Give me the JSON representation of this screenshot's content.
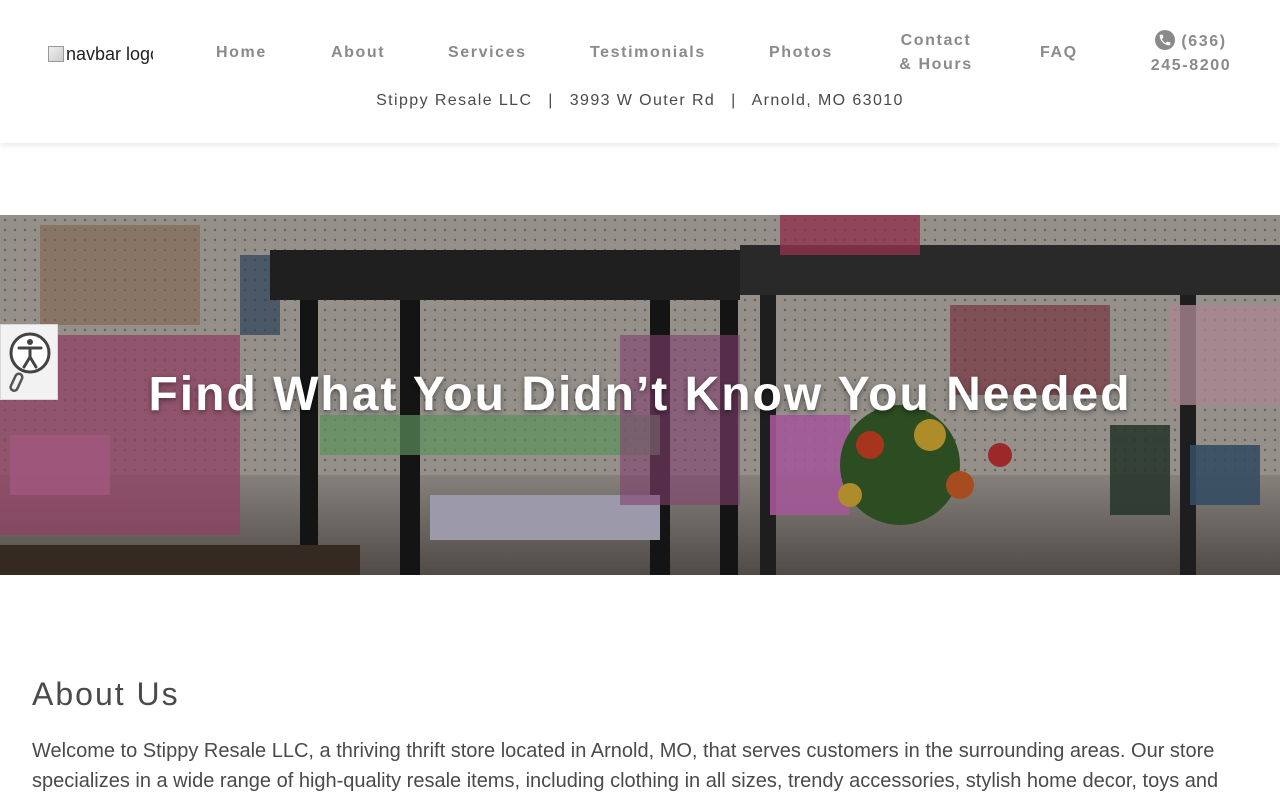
{
  "header": {
    "logo_alt": "navbar logo",
    "nav": {
      "home": "Home",
      "about": "About",
      "services": "Services",
      "testimonials": "Testimonials",
      "photos": "Photos",
      "contact_line1": "Contact",
      "contact_line2": "& Hours",
      "faq": "FAQ",
      "phone_line1": "(636)",
      "phone_line2": "245-8200"
    },
    "address": {
      "business": "Stippy Resale LLC",
      "street": "3993 W Outer Rd",
      "city": "Arnold, MO 63010",
      "separator": "|"
    }
  },
  "hero": {
    "title": "Find What You Didn’t Know You Needed"
  },
  "about": {
    "title": "About Us",
    "text": "Welcome to Stippy Resale LLC, a thriving thrift store located in Arnold, MO, that serves customers in the surrounding areas. Our store specializes in a wide range of high-quality resale items, including clothing in all sizes, trendy accessories, stylish home decor, toys and"
  },
  "icons": {
    "phone": "phone-icon",
    "accessibility": "accessibility-icon"
  },
  "colors": {
    "nav_text": "#8a8a8a",
    "body_text": "#4a4a4a",
    "hero_text": "#ffffff"
  }
}
